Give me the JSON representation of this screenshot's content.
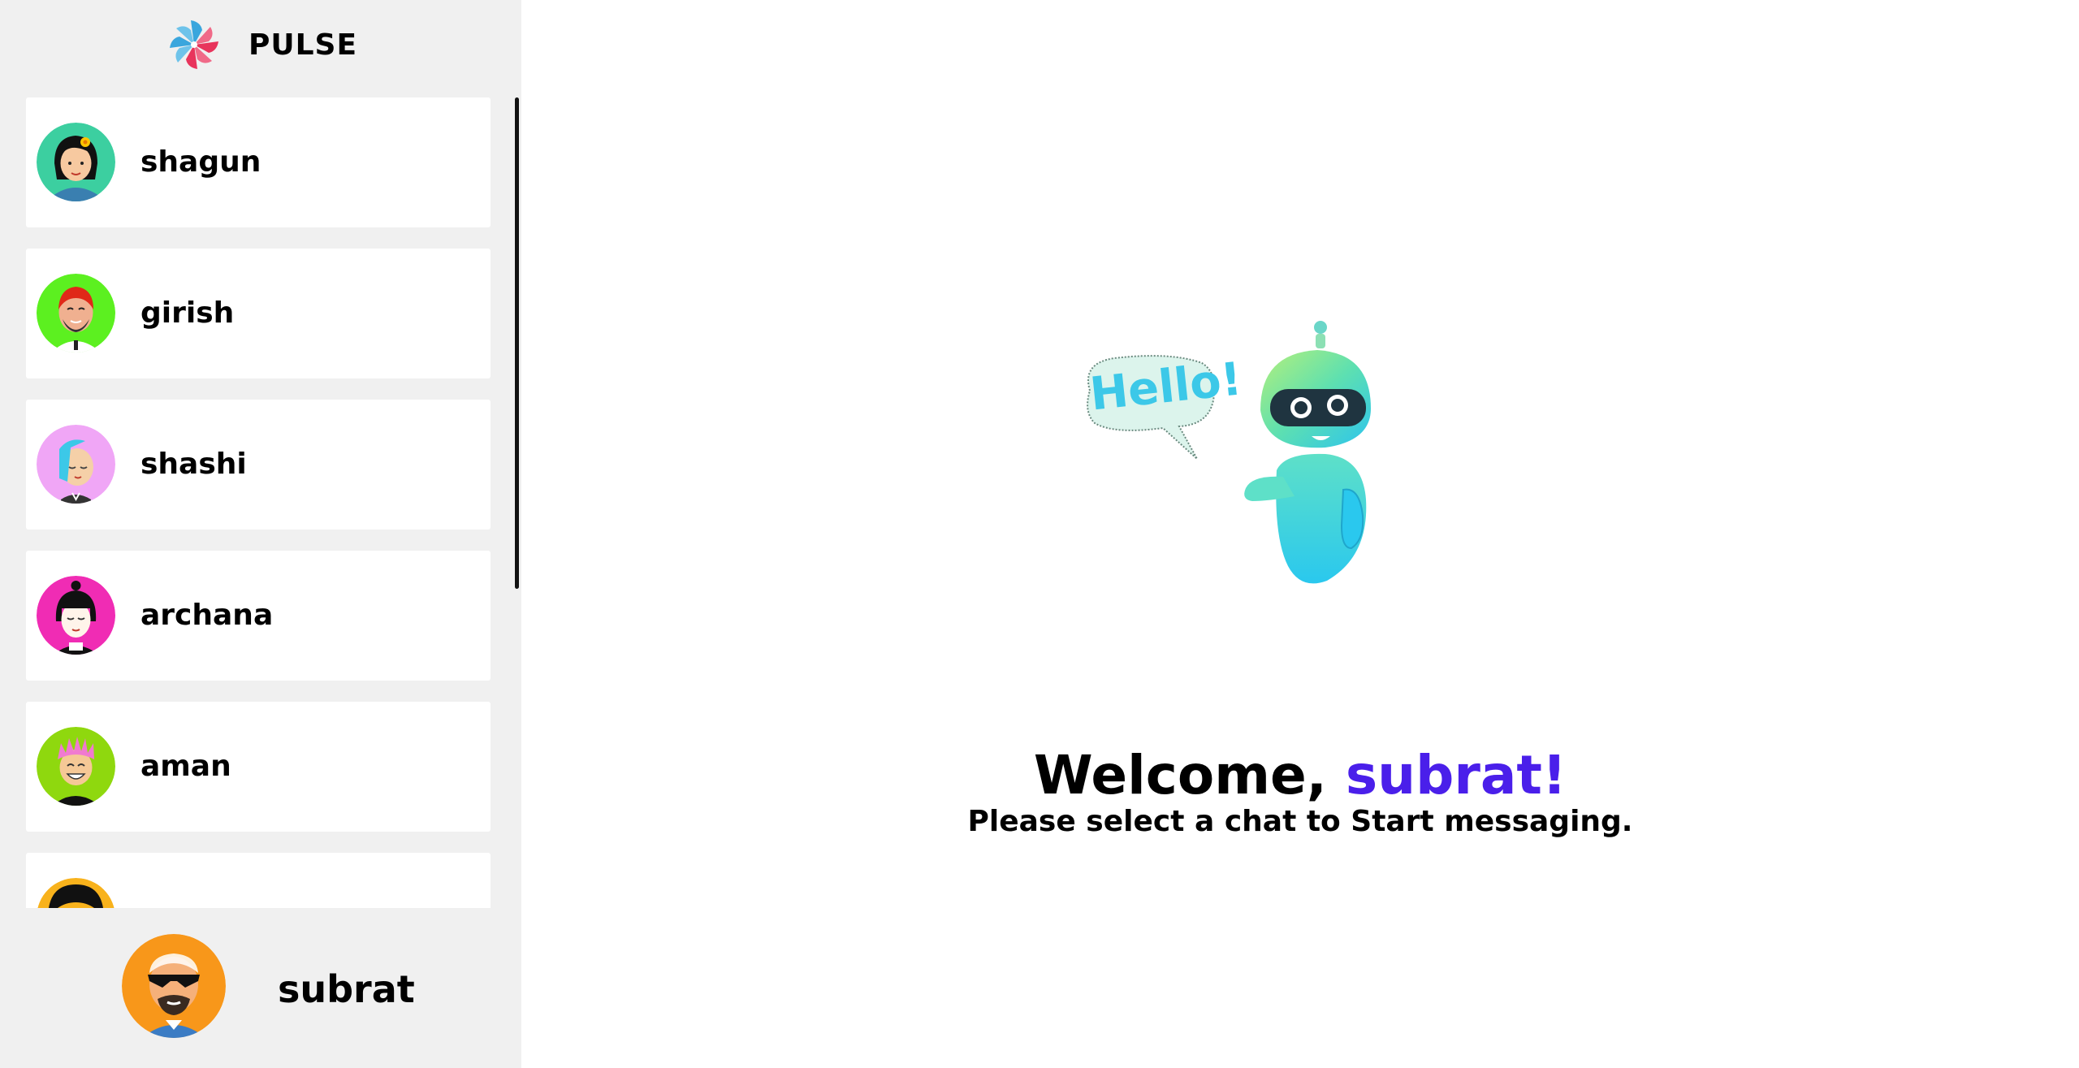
{
  "brand": {
    "name": "PULSE",
    "logo_icon": "pinwheel-logo-icon"
  },
  "contacts": [
    {
      "name": "shagun",
      "avatar_bg": "#3ccfa0"
    },
    {
      "name": "girish",
      "avatar_bg": "#5cf020"
    },
    {
      "name": "shashi",
      "avatar_bg": "#f0a6f6"
    },
    {
      "name": "archana",
      "avatar_bg": "#f02cb4"
    },
    {
      "name": "aman",
      "avatar_bg": "#8fd80e"
    },
    {
      "name": "",
      "avatar_bg": "#f8b21c"
    }
  ],
  "current_user": {
    "name": "subrat",
    "avatar_bg": "#f8971a"
  },
  "main": {
    "welcome_prefix": "Welcome,",
    "welcome_name": "subrat!",
    "subtitle": "Please select a chat to Start messaging.",
    "bubble_text": "Hello!"
  },
  "colors": {
    "accent": "#4a1fea",
    "sidebar_bg": "#f0f0f0"
  }
}
